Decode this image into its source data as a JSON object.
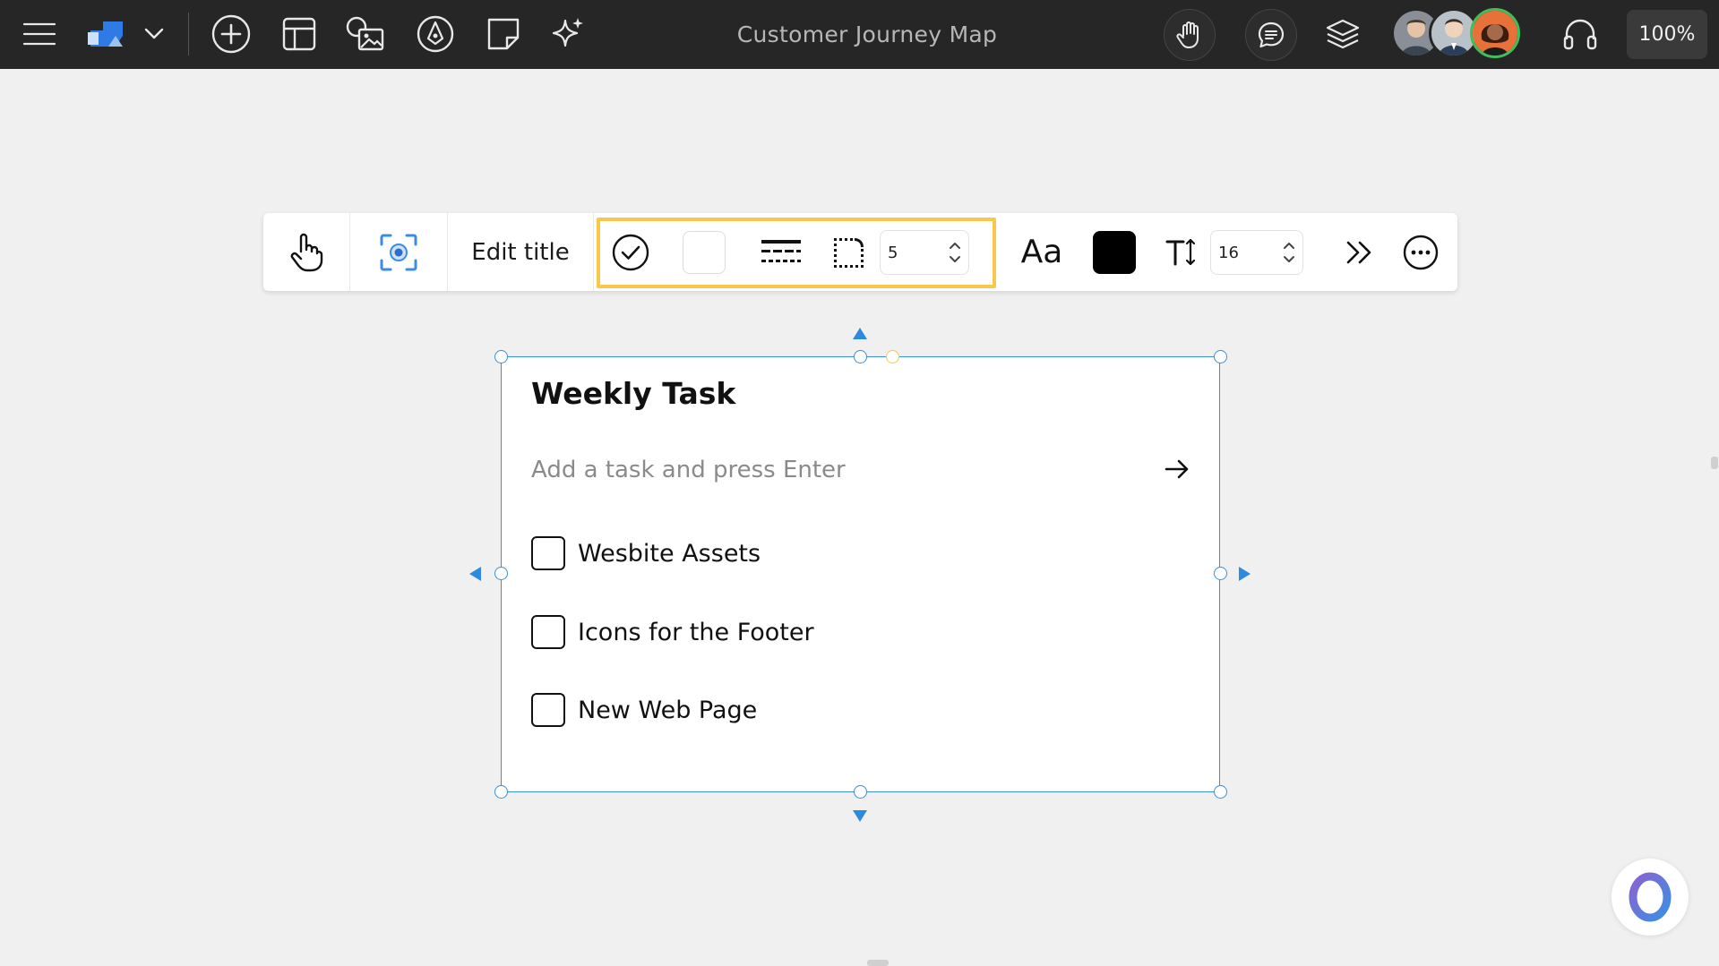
{
  "header": {
    "title": "Customer Journey Map",
    "zoom": "100%",
    "avatars": [
      "user-avatar-1",
      "user-avatar-2",
      "user-avatar-3"
    ]
  },
  "toolbar": {
    "edit_title_label": "Edit title",
    "border_width_value": "5",
    "font_label": "Aa",
    "font_size_value": "16",
    "highlight_color": "#f7c84a",
    "text_color": "#000000"
  },
  "widget": {
    "title": "Weekly Task",
    "input_placeholder": "Add a task and press Enter",
    "tasks": [
      {
        "label": "Wesbite Assets",
        "checked": false
      },
      {
        "label": "Icons for the Footer",
        "checked": false
      },
      {
        "label": "New Web Page",
        "checked": false
      }
    ]
  },
  "colors": {
    "topbar": "#262626",
    "canvas": "#f0f0f0",
    "selection": "#3c8fd6"
  }
}
